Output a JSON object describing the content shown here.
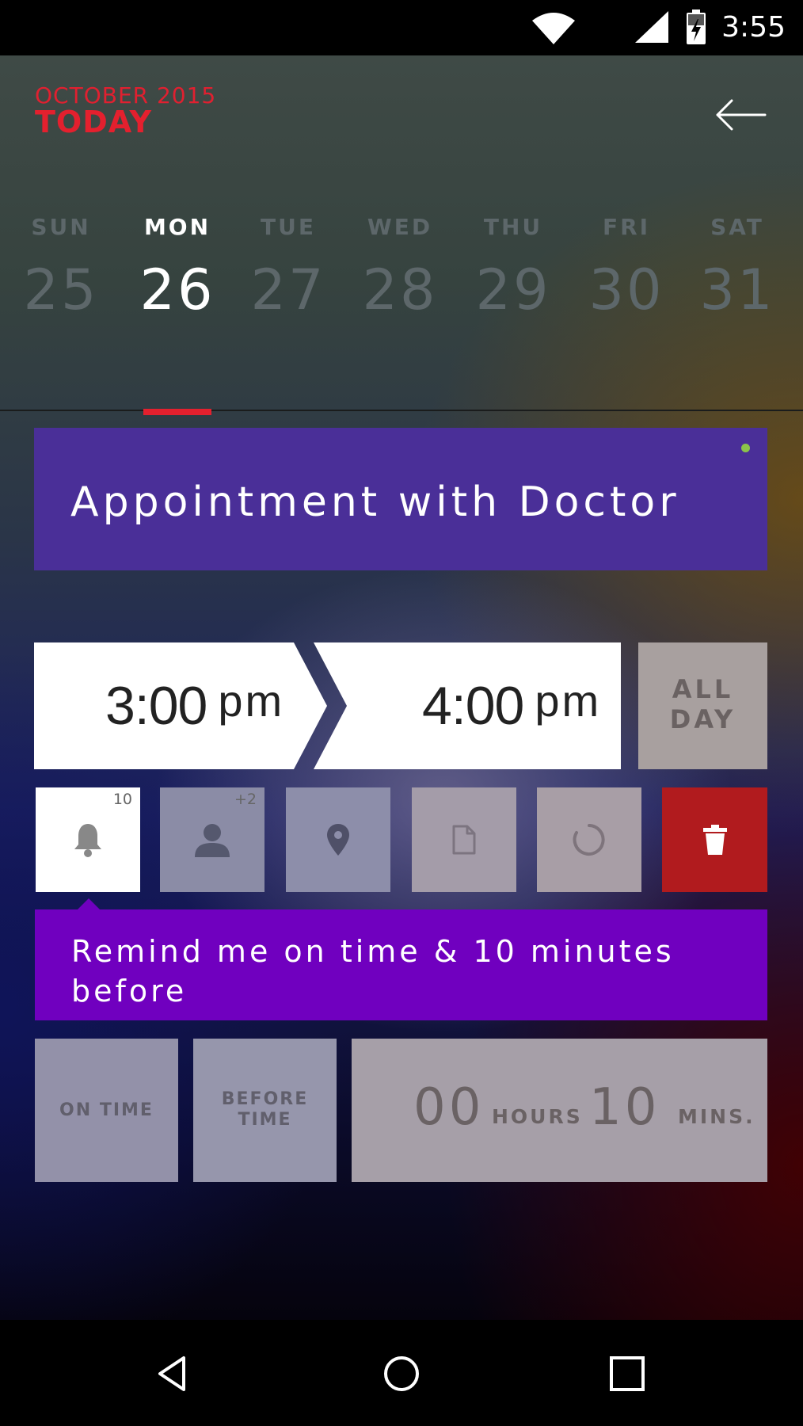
{
  "status_bar": {
    "time": "3:55",
    "icons": [
      "wifi-icon",
      "signal-icon",
      "battery-charging-icon"
    ]
  },
  "header": {
    "month": "OCTOBER 2015",
    "today": "TODAY",
    "back_icon": "arrow-left-icon"
  },
  "week": {
    "days": [
      {
        "name": "SUN",
        "num": "25"
      },
      {
        "name": "MON",
        "num": "26"
      },
      {
        "name": "TUE",
        "num": "27"
      },
      {
        "name": "WED",
        "num": "28"
      },
      {
        "name": "THU",
        "num": "29"
      },
      {
        "name": "FRI",
        "num": "30"
      },
      {
        "name": "SAT",
        "num": "31"
      }
    ],
    "selected_index": 1
  },
  "event": {
    "title": "Appointment with Doctor",
    "start": {
      "time": "3:00",
      "ampm": "pm"
    },
    "end": {
      "time": "4:00",
      "ampm": "pm"
    },
    "all_day": {
      "line1": "ALL",
      "line2": "DAY"
    }
  },
  "tiles": [
    {
      "icon": "bell-icon",
      "badge": "10"
    },
    {
      "icon": "person-icon",
      "badge": "+2"
    },
    {
      "icon": "location-pin-icon",
      "badge": ""
    },
    {
      "icon": "document-icon",
      "badge": ""
    },
    {
      "icon": "repeat-circle-icon",
      "badge": ""
    },
    {
      "icon": "trash-icon",
      "badge": ""
    }
  ],
  "reminder": {
    "text": "Remind me on time & 10 minutes before",
    "on_time": "ON TIME",
    "before_time": {
      "line1": "BEFORE",
      "line2": "TIME"
    },
    "hours_value": "00",
    "hours_label": "HOURS",
    "mins_value": "10",
    "mins_label": "MINS."
  },
  "colors": {
    "accent_red": "#e4202e",
    "event_purple": "#4a2f98",
    "reminder_purple": "#7000bf",
    "delete_red": "#b11b1e",
    "status_dot": "#8bc34a"
  },
  "nav": {
    "icons": [
      "back-triangle-icon",
      "home-circle-icon",
      "recents-square-icon"
    ]
  }
}
